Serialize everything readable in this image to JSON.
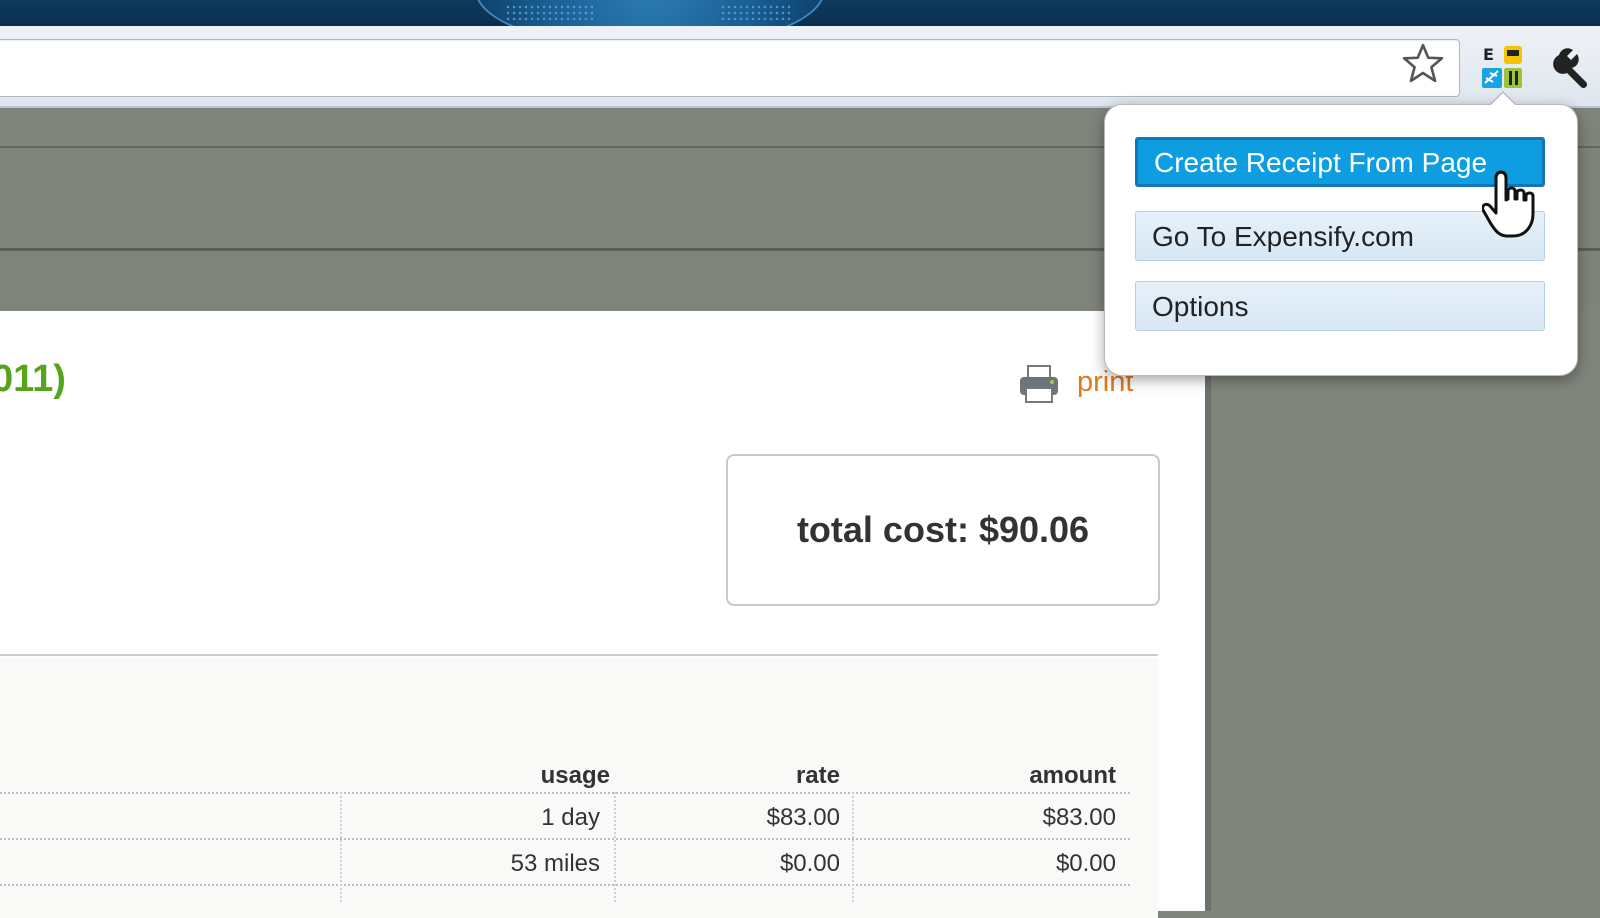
{
  "popup": {
    "items": [
      {
        "label": "Create Receipt From Page"
      },
      {
        "label": "Go To Expensify.com"
      },
      {
        "label": "Options"
      }
    ]
  },
  "page": {
    "title_fragment": "011)",
    "print_label": "print",
    "total_cost_label": "total cost: $90.06"
  },
  "table": {
    "headers": [
      "usage",
      "rate",
      "amount"
    ],
    "rows": [
      [
        "1 day",
        "$83.00",
        "$83.00"
      ],
      [
        "53 miles",
        "$0.00",
        "$0.00"
      ]
    ]
  },
  "icons": [
    "star-icon",
    "expensify-extension-icon",
    "wrench-icon",
    "printer-icon",
    "hand-cursor-icon"
  ],
  "colors": {
    "accent_blue": "#0e9de0",
    "title_green": "#55a51c",
    "print_orange": "#e07b1b"
  }
}
